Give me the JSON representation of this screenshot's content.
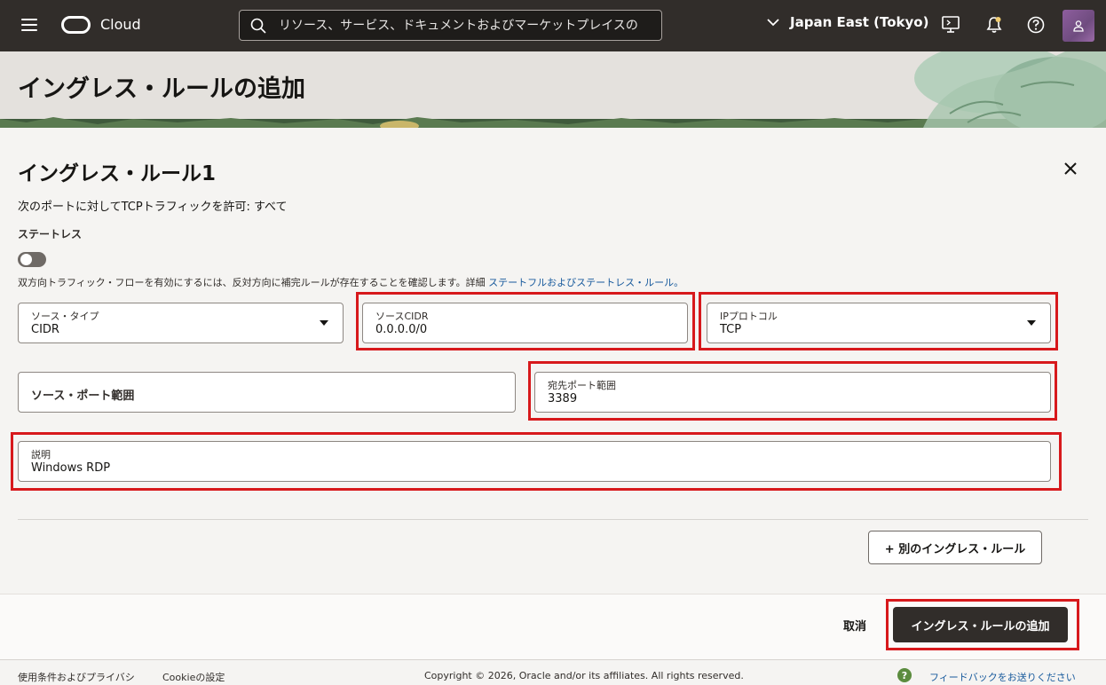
{
  "nav": {
    "brand": "Cloud",
    "search_placeholder": "リソース、サービス、ドキュメントおよびマーケットプレイスの",
    "region": "Japan East (Tokyo)"
  },
  "page": {
    "title": "イングレス・ルールの追加"
  },
  "rule": {
    "title": "イングレス・ルール1",
    "summary": "次のポートに対してTCPトラフィックを許可: すべて",
    "stateless_label": "ステートレス",
    "help_text": "双方向トラフィック・フローを有効にするには、反対方向に補完ルールが存在することを確認します。詳細",
    "help_link": "ステートフルおよびステートレス・ルール。",
    "fields": {
      "source_type": {
        "label": "ソース・タイプ",
        "value": "CIDR"
      },
      "source_cidr": {
        "label": "ソースCIDR",
        "value": "0.0.0.0/0"
      },
      "ip_protocol": {
        "label": "IPプロトコル",
        "value": "TCP"
      },
      "source_port": {
        "placeholder": "ソース・ポート範囲"
      },
      "dest_port": {
        "label": "宛先ポート範囲",
        "value": "3389"
      },
      "description": {
        "label": "説明",
        "value": "Windows RDP"
      }
    },
    "add_another": "+ 別のイングレス・ルール"
  },
  "actions": {
    "cancel": "取消",
    "submit": "イングレス・ルールの追加"
  },
  "footer": {
    "terms": "使用条件およびプライバシ",
    "cookie": "Cookieの設定",
    "copyright": "Copyright © 2026, Oracle and/or its affiliates. All rights reserved.",
    "feedback": "フィードバックをお送りください"
  }
}
